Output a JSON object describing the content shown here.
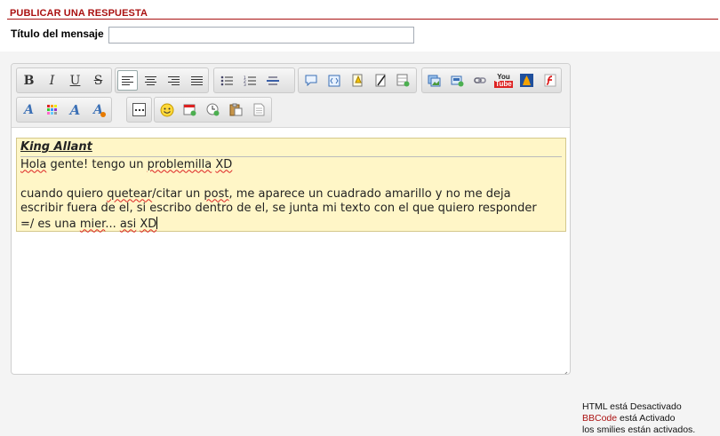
{
  "section": {
    "title": "PUBLICAR UNA RESPUESTA"
  },
  "subject": {
    "label": "Título del mensaje",
    "value": ""
  },
  "toolbar": {
    "row1": [
      "bold-icon",
      "italic-icon",
      "underline-icon",
      "strikethrough-icon",
      "align-left-icon",
      "align-center-icon",
      "align-right-icon",
      "align-justify-icon",
      "bullet-list-icon",
      "numbered-list-icon",
      "horizontal-rule-icon",
      "quote-icon",
      "code-icon",
      "spoiler-icon",
      "hide-icon",
      "table-icon",
      "image-icon",
      "image-upload-icon",
      "link-icon",
      "youtube-icon",
      "dailymotion-icon",
      "flash-icon"
    ],
    "row2": [
      "font-icon",
      "color-icon",
      "font-size-icon",
      "remove-format-icon",
      "more-icon",
      "smiley-icon",
      "date-icon",
      "time-icon",
      "paste-icon",
      "source-icon"
    ],
    "youtube_label_top": "You",
    "youtube_label_bottom": "Tube"
  },
  "message": {
    "quote_author": "King Allant",
    "line1_a": "Hola",
    "line1_b": " gente! tengo un ",
    "line1_c": "problemilla",
    "line1_d": " ",
    "line1_e": "XD",
    "line2_a": "cuando quiero ",
    "line2_b": "quetear",
    "line2_c": "/citar un ",
    "line2_d": "post",
    "line2_e": ", me aparece un cuadrado amarillo y no me deja",
    "line3": "escribir fuera de el, si escribo dentro de el, se junta mi texto con el que quiero responder",
    "line4_a": "=/ es una ",
    "line4_b": "mier",
    "line4_c": "... ",
    "line4_d": "asi",
    "line4_e": " ",
    "line4_f": "XD"
  },
  "status": {
    "html_text": "HTML está Desactivado",
    "bbcode_link": "BBCode",
    "bbcode_rest": " está Activado",
    "smilies_text": "los smilies están activados."
  },
  "colors": {
    "accent": "#aa1111",
    "quote_bg": "#fff6c7"
  }
}
